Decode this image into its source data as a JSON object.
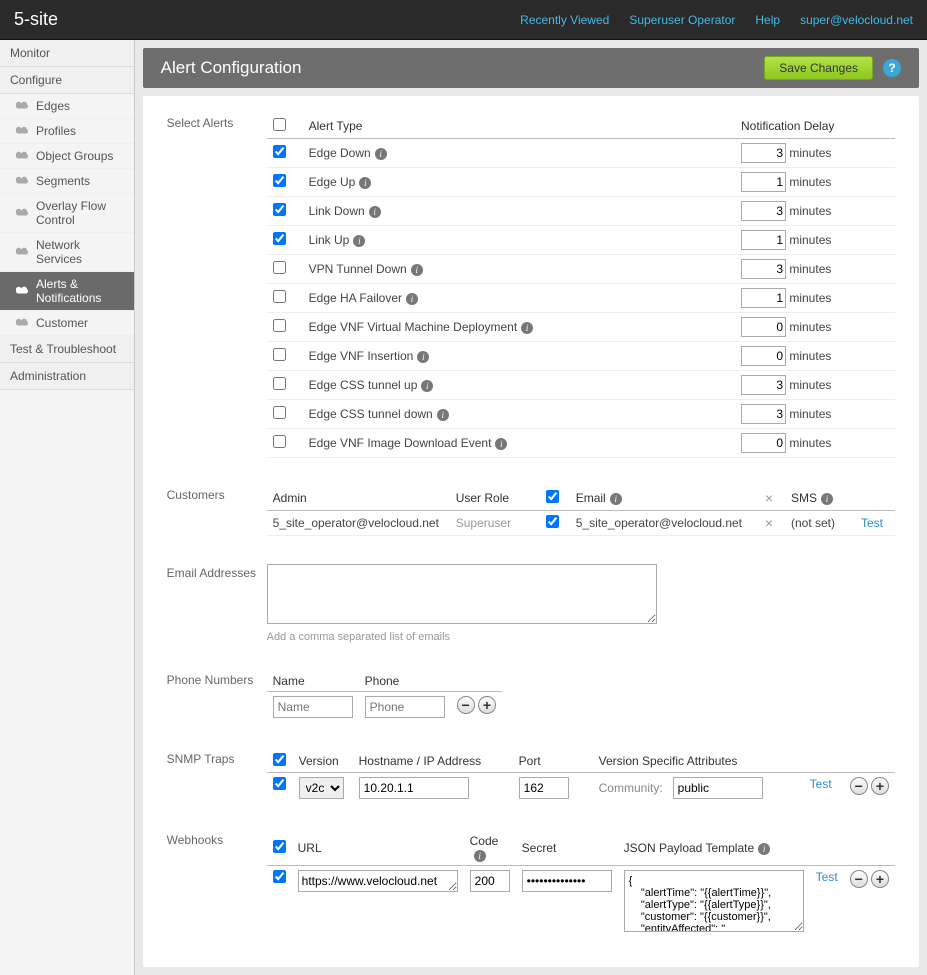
{
  "brand": "5-site",
  "top_links": [
    "Recently Viewed",
    "Superuser Operator",
    "Help",
    "super@velocloud.net"
  ],
  "sidebar": {
    "sections": [
      {
        "label": "Monitor",
        "items": []
      },
      {
        "label": "Configure",
        "items": [
          "Edges",
          "Profiles",
          "Object Groups",
          "Segments",
          "Overlay Flow Control",
          "Network Services",
          "Alerts & Notifications",
          "Customer"
        ],
        "active_index": 6
      },
      {
        "label": "Test & Troubleshoot",
        "items": []
      },
      {
        "label": "Administration",
        "items": []
      }
    ]
  },
  "page_title": "Alert Configuration",
  "save_label": "Save Changes",
  "alerts_section": {
    "label": "Select Alerts",
    "header_chk_label": "",
    "col_type": "Alert Type",
    "col_delay": "Notification Delay",
    "unit": "minutes",
    "rows": [
      {
        "checked": true,
        "label": "Edge Down",
        "info": true,
        "delay": "3"
      },
      {
        "checked": true,
        "label": "Edge Up",
        "info": true,
        "delay": "1"
      },
      {
        "checked": true,
        "label": "Link Down",
        "info": true,
        "delay": "3"
      },
      {
        "checked": true,
        "label": "Link Up",
        "info": true,
        "delay": "1"
      },
      {
        "checked": false,
        "label": "VPN Tunnel Down",
        "info": true,
        "delay": "3"
      },
      {
        "checked": false,
        "label": "Edge HA Failover",
        "info": true,
        "delay": "1"
      },
      {
        "checked": false,
        "label": "Edge VNF Virtual Machine Deployment",
        "info": true,
        "delay": "0"
      },
      {
        "checked": false,
        "label": "Edge VNF Insertion",
        "info": true,
        "delay": "0"
      },
      {
        "checked": false,
        "label": "Edge CSS tunnel up",
        "info": true,
        "delay": "3"
      },
      {
        "checked": false,
        "label": "Edge CSS tunnel down",
        "info": true,
        "delay": "3"
      },
      {
        "checked": false,
        "label": "Edge VNF Image Download Event",
        "info": true,
        "delay": "0"
      }
    ]
  },
  "customers_section": {
    "label": "Customers",
    "cols": {
      "admin": "Admin",
      "role": "User Role",
      "email_h": "Email",
      "sms_h": "SMS"
    },
    "rows": [
      {
        "admin": "5_site_operator@velocloud.net",
        "role": "Superuser",
        "email_chk": true,
        "email": "5_site_operator@velocloud.net",
        "sms": "(not set)"
      }
    ],
    "test_label": "Test"
  },
  "email_section": {
    "label": "Email Addresses",
    "hint": "Add a comma separated list of emails"
  },
  "phone_section": {
    "label": "Phone Numbers",
    "col_name": "Name",
    "col_phone": "Phone",
    "name_ph": "Name",
    "phone_ph": "Phone"
  },
  "snmp_section": {
    "label": "SNMP Traps",
    "enable_chk": true,
    "col_version": "Version",
    "col_host": "Hostname / IP Address",
    "col_port": "Port",
    "col_attrs": "Version Specific Attributes",
    "row": {
      "chk": true,
      "version": "v2c",
      "host": "10.20.1.1",
      "port": "162",
      "community_lbl": "Community:",
      "community": "public"
    },
    "test_label": "Test"
  },
  "webhooks_section": {
    "label": "Webhooks",
    "enable_chk": true,
    "col_url": "URL",
    "col_code": "Code",
    "col_secret": "Secret",
    "col_payload": "JSON Payload Template",
    "row": {
      "chk": true,
      "url": "https://www.velocloud.net",
      "code": "200",
      "secret": "••••••••••••••",
      "payload": "{\n    \"alertTime\": \"{{alertTime}}\",\n    \"alertType\": \"{{alertType}}\",\n    \"customer\": \"{{customer}}\",\n    \"entityAffected\": \"{{entityAffected}}\","
    },
    "test_label": "Test"
  }
}
